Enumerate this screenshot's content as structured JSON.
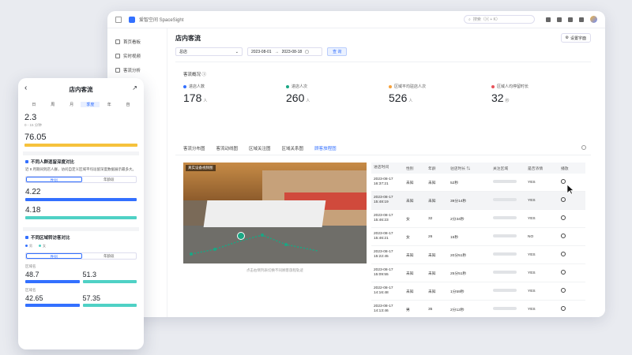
{
  "app": {
    "name": "爱智空间 SpaceSight",
    "search_placeholder": "搜索（⌘ + K）"
  },
  "sidebar": {
    "items": [
      {
        "label": "首页看板"
      },
      {
        "label": "实时视频"
      },
      {
        "label": "客流分析"
      }
    ]
  },
  "page": {
    "title": "店内客流",
    "settings_label": "设置字面",
    "store_select": "总店",
    "date_start": "2023-08-01",
    "date_end": "2023-08-18",
    "query_label": "查 询",
    "overview_title": "客流概况"
  },
  "stats": [
    {
      "label": "进店人数",
      "value": "178",
      "unit": "人",
      "color": "#3370ff"
    },
    {
      "label": "进店人次",
      "value": "260",
      "unit": "人",
      "color": "#1aa784"
    },
    {
      "label": "区域平均驻店人次",
      "value": "526",
      "unit": "人",
      "color": "#f6a23c"
    },
    {
      "label": "区域人均停留时长",
      "value": "32",
      "unit": "秒",
      "color": "#e8535a"
    }
  ],
  "tabs": [
    "客流分布图",
    "客流动线图",
    "区域关注图",
    "区域关系图",
    "顾客旅程图"
  ],
  "video": {
    "label": "真实设备视频图",
    "caption": "点击右侧列表切换不同顾客旅程轨迹"
  },
  "table": {
    "headers": [
      "进店时间",
      "性别",
      "年龄",
      "驻店时长",
      "⇅",
      "关注区域",
      "是否浓情",
      "播放"
    ],
    "rows": [
      {
        "time": "2023-08-17 16:37:21",
        "gender": "未知",
        "age": "未知",
        "stay": "52秒",
        "enter": "YES"
      },
      {
        "time": "2023-08-17 15:48:19",
        "gender": "未知",
        "age": "未知",
        "stay": "39分14秒",
        "enter": "YES"
      },
      {
        "time": "2023-08-17 15:46:23",
        "gender": "女",
        "age": "32",
        "stay": "2分34秒",
        "enter": "YES"
      },
      {
        "time": "2023-08-17 15:46:21",
        "gender": "女",
        "age": "26",
        "stay": "15秒",
        "enter": "NO"
      },
      {
        "time": "2023-08-17 15:22:45",
        "gender": "未知",
        "age": "未知",
        "stay": "20分51秒",
        "enter": "YES"
      },
      {
        "time": "2023-08-17 15:09:55",
        "gender": "未知",
        "age": "未知",
        "stay": "25分51秒",
        "enter": "YES"
      },
      {
        "time": "2022-08-17 14:16:48",
        "gender": "未知",
        "age": "未知",
        "stay": "1分59秒",
        "enter": "YES"
      },
      {
        "time": "2023-08-17 14:13:46",
        "gender": "男",
        "age": "35",
        "stay": "2分12秒",
        "enter": "YES"
      }
    ]
  },
  "mobile": {
    "title": "店内客流",
    "segments": [
      "日",
      "周",
      "月",
      "季度",
      "年",
      "自"
    ],
    "metric1": {
      "value": "2.3",
      "sub": "0 - 15 分钟"
    },
    "metric2": {
      "value": "76.05"
    },
    "card1": {
      "title": "不同人群逗留深度对比",
      "desc": "近 8 月期间到店人群，访问自定义区域平均逗留深度数据展示最多大。"
    },
    "toggle": [
      "性别",
      "年龄段"
    ],
    "v1": "4.22",
    "v2": "4.18",
    "card2": {
      "title": "不同区域转访客对比"
    },
    "zone1": "区域名",
    "zone2": "区域名",
    "p1a": "48.7",
    "p1b": "51.3",
    "p2a": "42.65",
    "p2b": "57.35",
    "legend": [
      "男",
      "女"
    ]
  },
  "colors": {
    "accent": "#3370ff",
    "green": "#1aa784",
    "orange": "#f6a23c",
    "red": "#e8535a",
    "teal": "#4fd1c5"
  }
}
